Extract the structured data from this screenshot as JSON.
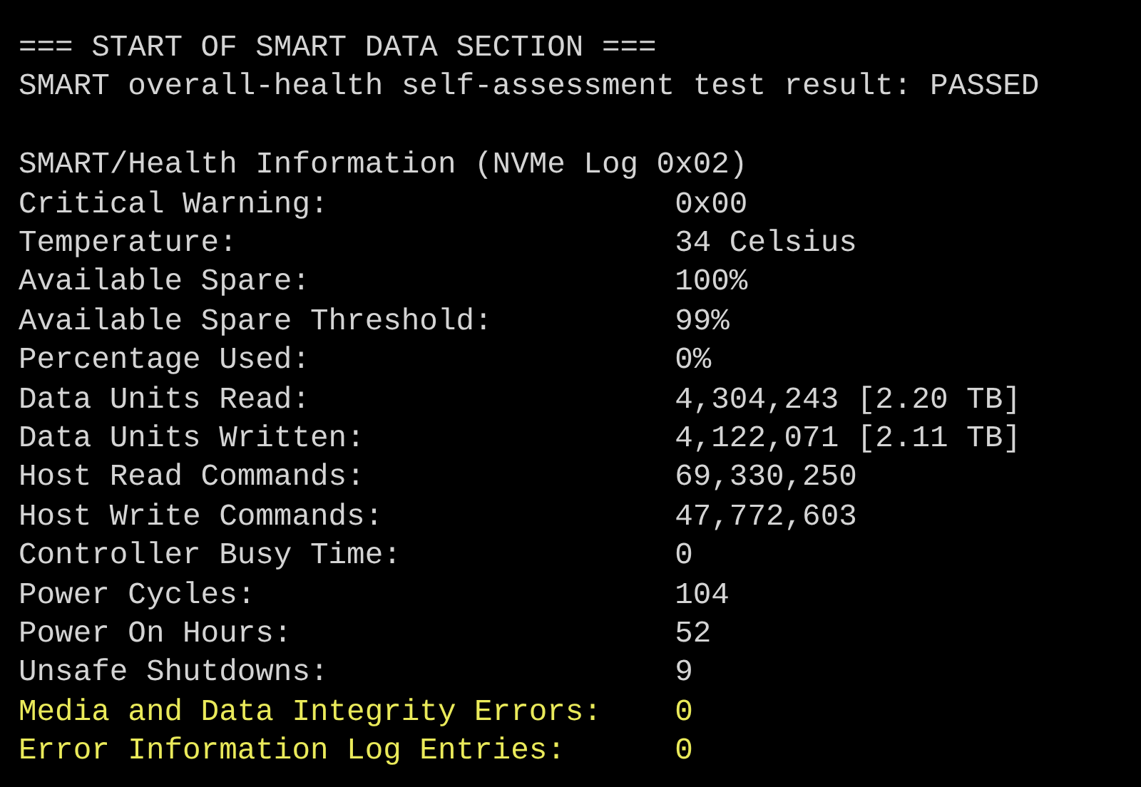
{
  "header_lines": [
    "=== START OF SMART DATA SECTION ===",
    "SMART overall-health self-assessment test result: PASSED"
  ],
  "section_title": "SMART/Health Information (NVMe Log 0x02)",
  "rows": [
    {
      "label": "Critical Warning:",
      "value": "0x00",
      "highlighted": false
    },
    {
      "label": "Temperature:",
      "value": "34 Celsius",
      "highlighted": false
    },
    {
      "label": "Available Spare:",
      "value": "100%",
      "highlighted": false
    },
    {
      "label": "Available Spare Threshold:",
      "value": "99%",
      "highlighted": false
    },
    {
      "label": "Percentage Used:",
      "value": "0%",
      "highlighted": false
    },
    {
      "label": "Data Units Read:",
      "value": "4,304,243 [2.20 TB]",
      "highlighted": false
    },
    {
      "label": "Data Units Written:",
      "value": "4,122,071 [2.11 TB]",
      "highlighted": false
    },
    {
      "label": "Host Read Commands:",
      "value": "69,330,250",
      "highlighted": false
    },
    {
      "label": "Host Write Commands:",
      "value": "47,772,603",
      "highlighted": false
    },
    {
      "label": "Controller Busy Time:",
      "value": "0",
      "highlighted": false
    },
    {
      "label": "Power Cycles:",
      "value": "104",
      "highlighted": false
    },
    {
      "label": "Power On Hours:",
      "value": "52",
      "highlighted": false
    },
    {
      "label": "Unsafe Shutdowns:",
      "value": "9",
      "highlighted": false
    },
    {
      "label": "Media and Data Integrity Errors:",
      "value": "0",
      "highlighted": true
    },
    {
      "label": "Error Information Log Entries:",
      "value": "0",
      "highlighted": true
    }
  ]
}
